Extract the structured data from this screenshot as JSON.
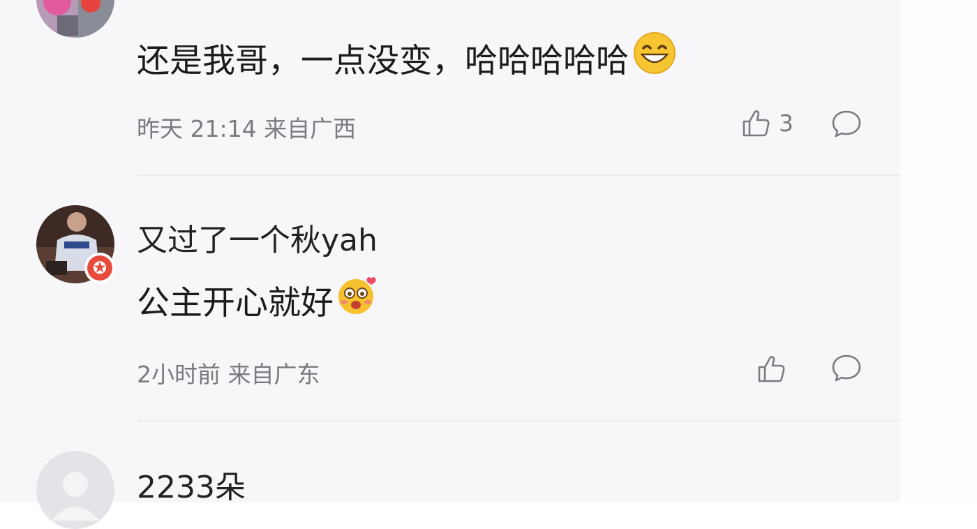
{
  "comments": [
    {
      "body": "还是我哥，一点没变，哈哈哈哈哈",
      "emoji": "grinning-face-emoji",
      "time": "昨天 21:14",
      "location": "来自广西",
      "likes": "3"
    },
    {
      "username": "又过了一个秋yah",
      "body": "公主开心就好",
      "emoji": "blushing-love-emoji",
      "time": "2小时前",
      "location": "来自广东",
      "badge_icon": "star-badge-icon"
    },
    {
      "username": "2233朵"
    }
  ],
  "icons": {
    "like": "thumbs-up-icon",
    "reply": "comment-bubble-icon"
  },
  "colors": {
    "background": "#f7f7fa",
    "text_primary": "#1b1b1b",
    "text_meta": "#7a7a80",
    "badge_red": "#e84a3c",
    "divider": "#ececf0"
  }
}
